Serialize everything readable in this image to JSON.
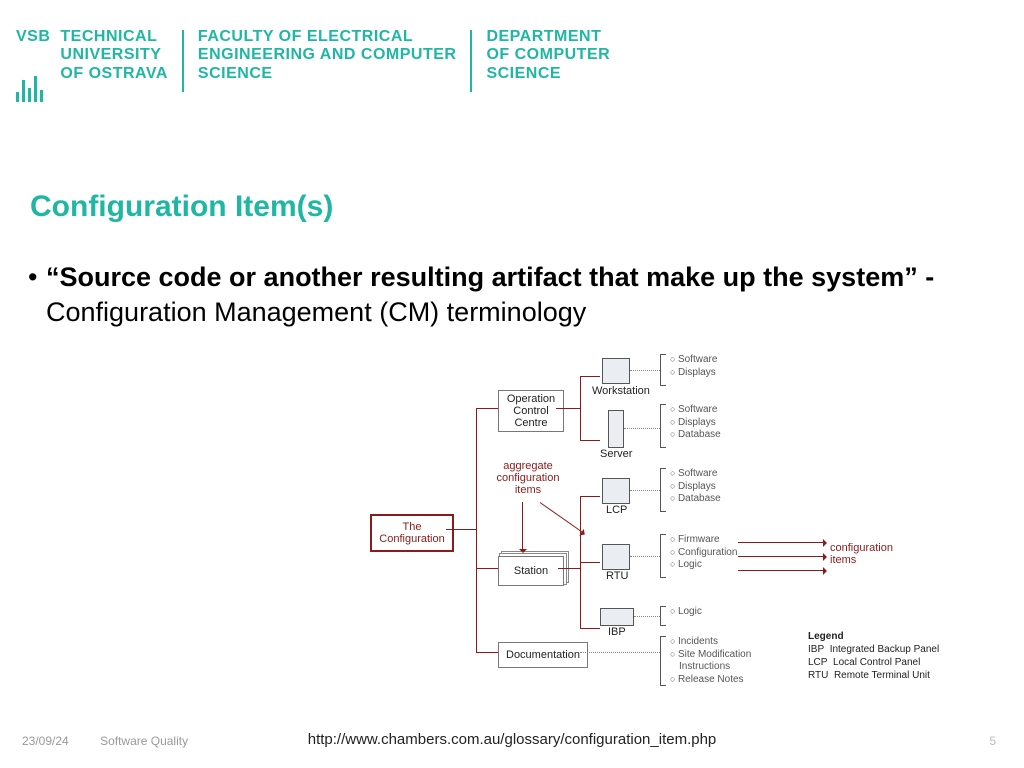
{
  "header": {
    "block1": {
      "l1": "VSB",
      "l2": "TECHNICAL",
      "l3": "UNIVERSITY",
      "l4": "OF OSTRAVA"
    },
    "block2": {
      "l1": "FACULTY OF ELECTRICAL",
      "l2": "ENGINEERING AND COMPUTER",
      "l3": "SCIENCE"
    },
    "block3": {
      "l1": "DEPARTMENT",
      "l2": "OF COMPUTER",
      "l3": "SCIENCE"
    }
  },
  "title": "Configuration Item(s)",
  "bullet": {
    "bold": "“Source code or another resulting artifact  that make up the system” - ",
    "rest": "Configuration Management (CM) terminology"
  },
  "diagram": {
    "root": "The\nConfiguration",
    "agg_label": "aggregate\nconfiguration\nitems",
    "nodes": {
      "occ": "Operation\nControl\nCentre",
      "station": "Station",
      "doc": "Documentation"
    },
    "devices": {
      "ws": "Workstation",
      "server": "Server",
      "lcp": "LCP",
      "rtu": "RTU",
      "ibp": "IBP"
    },
    "lists": {
      "ws": [
        "Software",
        "Displays"
      ],
      "server": [
        "Software",
        "Displays",
        "Database"
      ],
      "lcp": [
        "Software",
        "Displays",
        "Database"
      ],
      "rtu": [
        "Firmware",
        "Configuration",
        "Logic"
      ],
      "ibp": [
        "Logic"
      ],
      "doc": [
        "Incidents",
        "Site Modification Instructions",
        "Release Notes"
      ]
    },
    "ci_label": "configuration\nitems",
    "legend": {
      "title": "Legend",
      "rows": [
        {
          "a": "IBP",
          "b": "Integrated Backup Panel"
        },
        {
          "a": "LCP",
          "b": "Local Control Panel"
        },
        {
          "a": "RTU",
          "b": "Remote Terminal Unit"
        }
      ]
    }
  },
  "footer": {
    "date": "23/09/24",
    "course": "Software Quality",
    "page": "5",
    "url": "http://www.chambers.com.au/glossary/configuration_item.php"
  }
}
